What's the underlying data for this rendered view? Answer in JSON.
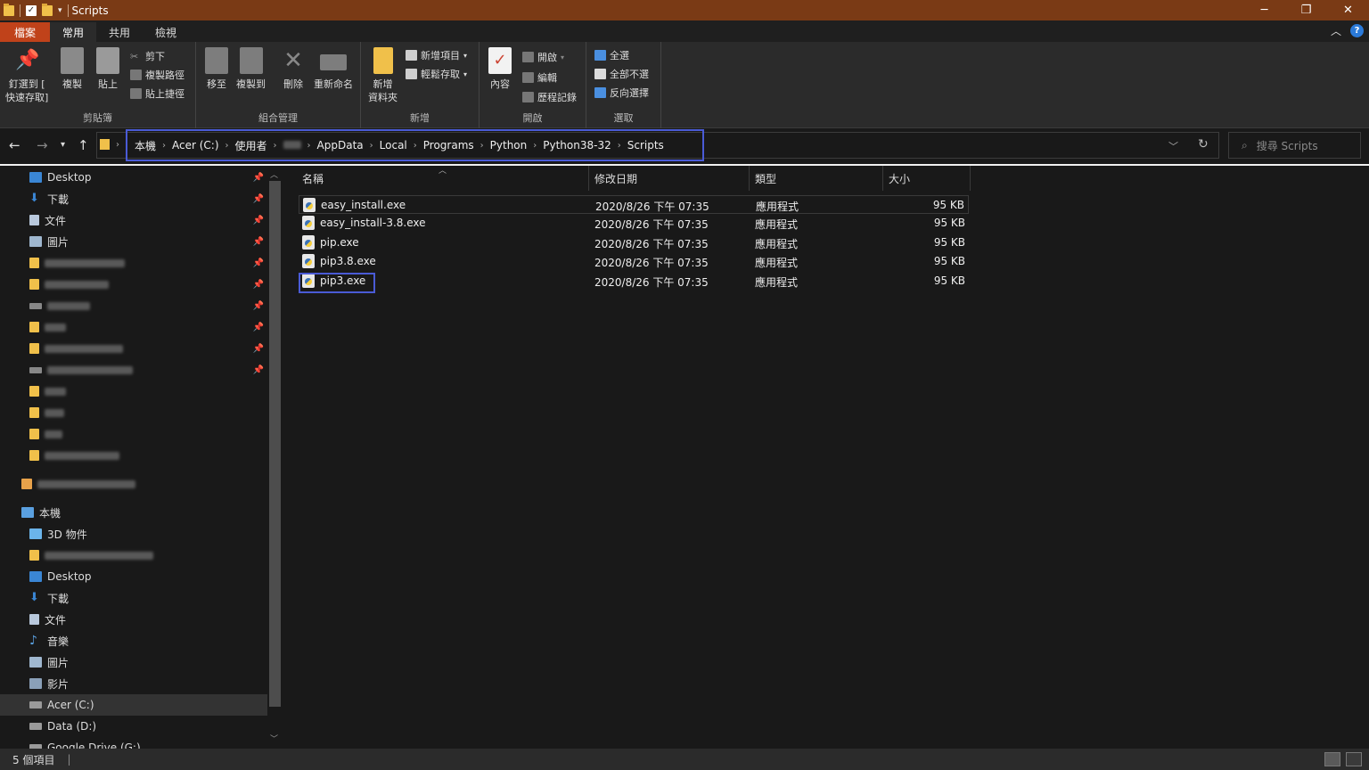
{
  "window": {
    "title": "Scripts",
    "accent": "#7a3a15"
  },
  "tabs": [
    {
      "label": "檔案"
    },
    {
      "label": "常用"
    },
    {
      "label": "共用"
    },
    {
      "label": "檢視"
    }
  ],
  "ribbon": {
    "clipboard": {
      "pin_label_1": "釘選到 [",
      "pin_label_2": "快速存取]",
      "copy": "複製",
      "paste": "貼上",
      "cut": "剪下",
      "copy_path": "複製路徑",
      "paste_shortcut": "貼上捷徑",
      "group": "剪貼簿"
    },
    "organize": {
      "move_to": "移至",
      "copy_to": "複製到",
      "delete": "刪除",
      "rename": "重新命名",
      "group": "組合管理"
    },
    "new": {
      "new_folder_1": "新增",
      "new_folder_2": "資料夾",
      "new_item": "新增項目",
      "easy_access": "輕鬆存取",
      "group": "新增"
    },
    "open": {
      "properties": "內容",
      "open": "開啟",
      "edit": "編輯",
      "history": "歷程記錄",
      "group": "開啟"
    },
    "select": {
      "select_all": "全選",
      "select_none": "全部不選",
      "invert": "反向選擇",
      "group": "選取"
    }
  },
  "address": {
    "crumbs": [
      "本機",
      "Acer (C:)",
      "使用者",
      "AppData",
      "Local",
      "Programs",
      "Python",
      "Python38-32",
      "Scripts"
    ],
    "search_placeholder": "搜尋 Scripts"
  },
  "sidebar": {
    "quick": [
      {
        "label": "Desktop",
        "icon": "desktop-icon"
      },
      {
        "label": "下載",
        "icon": "download-icon"
      },
      {
        "label": "文件",
        "icon": "document-icon"
      },
      {
        "label": "圖片",
        "icon": "picture-icon"
      }
    ],
    "this_pc": "本機",
    "pc_items": [
      {
        "label": "3D 物件",
        "icon": "3d-icon"
      },
      {
        "label": "Desktop",
        "icon": "desktop-icon"
      },
      {
        "label": "下載",
        "icon": "download-icon"
      },
      {
        "label": "文件",
        "icon": "document-icon"
      },
      {
        "label": "音樂",
        "icon": "music-icon"
      },
      {
        "label": "圖片",
        "icon": "picture-icon"
      },
      {
        "label": "影片",
        "icon": "video-icon"
      },
      {
        "label": "Acer (C:)",
        "icon": "drive-icon"
      },
      {
        "label": "Data (D:)",
        "icon": "drive-icon"
      },
      {
        "label": "Google Drive (G:)",
        "icon": "drive-icon"
      }
    ]
  },
  "columns": {
    "name": "名稱",
    "date": "修改日期",
    "type": "類型",
    "size": "大小"
  },
  "files": [
    {
      "name": "easy_install.exe",
      "date": "2020/8/26 下午 07:35",
      "type": "應用程式",
      "size": "95 KB"
    },
    {
      "name": "easy_install-3.8.exe",
      "date": "2020/8/26 下午 07:35",
      "type": "應用程式",
      "size": "95 KB"
    },
    {
      "name": "pip.exe",
      "date": "2020/8/26 下午 07:35",
      "type": "應用程式",
      "size": "95 KB"
    },
    {
      "name": "pip3.8.exe",
      "date": "2020/8/26 下午 07:35",
      "type": "應用程式",
      "size": "95 KB"
    },
    {
      "name": "pip3.exe",
      "date": "2020/8/26 下午 07:35",
      "type": "應用程式",
      "size": "95 KB"
    }
  ],
  "status": {
    "count": "5 個項目"
  }
}
